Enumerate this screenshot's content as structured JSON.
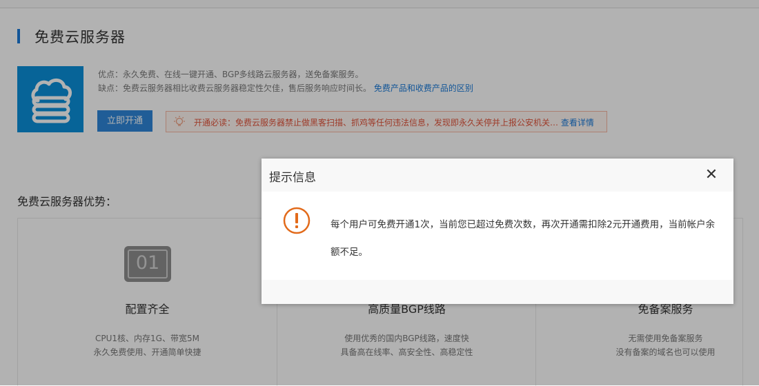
{
  "page": {
    "title": "免费云服务器",
    "pros": "优点：永久免费、在线一键开通、BGP多线路云服务器，送免备案服务。",
    "cons_text": "缺点：免费云服务器相比收费云服务器稳定性欠佳，售后服务响应时间长。",
    "cons_link": "免费产品和收费产品的区别",
    "open_button": "立即开通",
    "notice_text": "开通必读：免费云服务器禁止做黑客扫描、抓鸡等任何违法信息，发现即永久关停并上报公安机关…",
    "notice_link": "查看详情",
    "advantages_title": "免费云服务器优势："
  },
  "cards": [
    {
      "icon_text": "01",
      "title": "配置齐全",
      "line1": "CPU1核、内存1G、带宽5M",
      "line2": "永久免费使用、开通简单快捷"
    },
    {
      "title": "高质量BGP线路",
      "line1": "使用优秀的国内BGP线路，速度快",
      "line2": "具备高在线率、高安全性、高稳定性"
    },
    {
      "title": "免备案服务",
      "line1": "无需使用免备案服务",
      "line2": "没有备案的域名也可以使用"
    }
  ],
  "dialog": {
    "title": "提示信息",
    "close": "✕",
    "message": "每个用户可免费开通1次，当前您已超过免费次数，再次开通需扣除2元开通费用，当前帐户余额不足。"
  },
  "colors": {
    "accent": "#1a7ad9",
    "cloud_bg": "#0b90da",
    "warning": "#e26a1a",
    "notice_text": "#e2553c"
  },
  "icons": [
    "cloud-server-icon",
    "lightbulb-icon",
    "number-01-icon",
    "warning-icon",
    "close-icon"
  ]
}
